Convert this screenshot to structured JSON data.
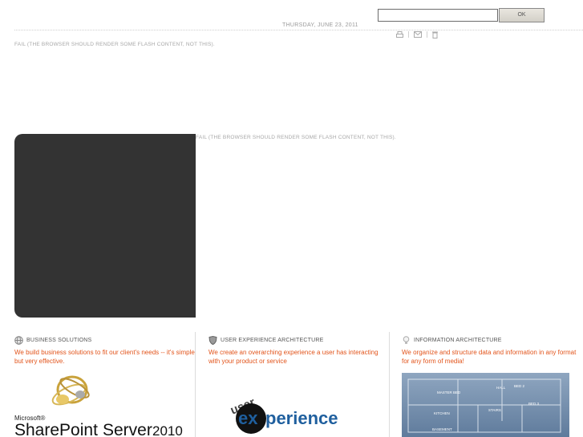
{
  "header": {
    "date": "THURSDAY, JUNE 23, 2011",
    "search": {
      "value": "",
      "placeholder": ""
    },
    "ok_label": "OK",
    "tools": [
      "print-icon",
      "mail-icon",
      "trash-icon"
    ]
  },
  "flash_fallback_1": "FAIL (THE BROWSER SHOULD RENDER SOME FLASH CONTENT, NOT THIS).",
  "flash_fallback_2": "FAIL (THE BROWSER SHOULD RENDER SOME FLASH CONTENT, NOT THIS).",
  "columns": [
    {
      "title": "BUSINESS SOLUTIONS",
      "text": "We build business solutions to fit our client's needs -- it's simple but very effective.",
      "icon": "globe-icon",
      "image": {
        "microsoft": "Microsoft®",
        "product": "SharePoint",
        "product2": "Server",
        "year": "2010"
      }
    },
    {
      "title": "USER EXPERIENCE ARCHITECTURE",
      "text": "We create an overarching experience a user has interacting with your product or service",
      "icon": "shield-icon",
      "image": {
        "top": "user",
        "circle": "ex",
        "rest": "perience"
      }
    },
    {
      "title": "INFORMATION ARCHITECTURE",
      "text": "We organize and structure data and information in any format for any form of media!",
      "icon": "lightbulb-icon",
      "image": {
        "labels": [
          "MASTER BED",
          "HALL",
          "BED 2",
          "BED 3",
          "KITCHEN",
          "STAIRS",
          "BASEMENT"
        ]
      }
    }
  ],
  "colors": {
    "accent": "#e2541b",
    "panel": "#333333",
    "muted": "#a7a7a7"
  }
}
